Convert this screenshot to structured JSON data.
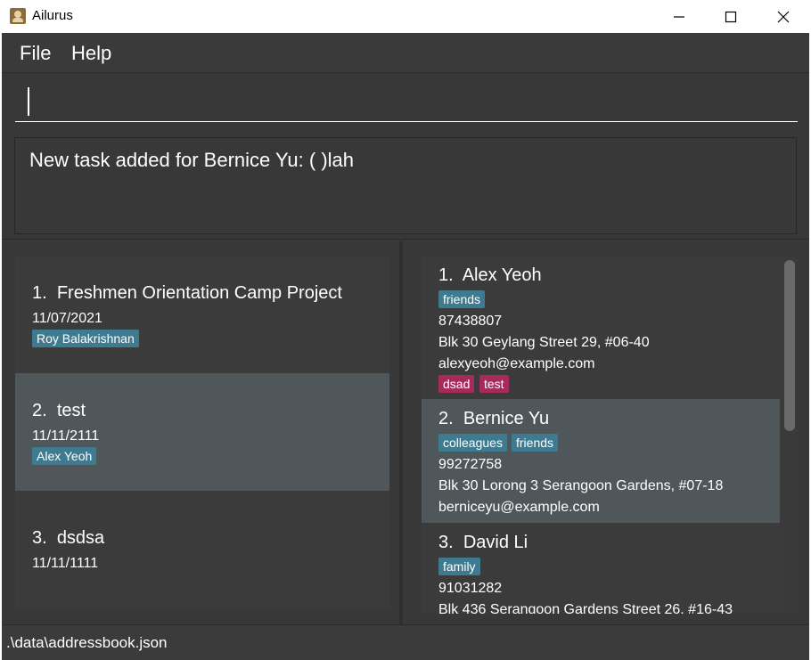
{
  "window": {
    "title": "Ailurus"
  },
  "menu": {
    "file": "File",
    "help": "Help"
  },
  "command": {
    "value": "",
    "placeholder": ""
  },
  "result": {
    "text": "New task added for Bernice Yu: ( )lah"
  },
  "tasks": [
    {
      "index": "1.",
      "title": "Freshmen Orientation Camp Project",
      "date": "11/07/2021",
      "members": [
        "Roy Balakrishnan"
      ]
    },
    {
      "index": "2.",
      "title": "test",
      "date": "11/11/2111",
      "members": [
        "Alex Yeoh"
      ]
    },
    {
      "index": "3.",
      "title": "dsdsa",
      "date": "11/11/1111",
      "members": []
    }
  ],
  "persons": [
    {
      "index": "1.",
      "name": "Alex Yeoh",
      "tags": [
        "friends"
      ],
      "phone": "87438807",
      "address": "Blk 30 Geylang Street 29, #06-40",
      "email": "alexyeoh@example.com",
      "task_tags": [
        "dsad",
        "test"
      ]
    },
    {
      "index": "2.",
      "name": "Bernice Yu",
      "tags": [
        "colleagues",
        "friends"
      ],
      "phone": "99272758",
      "address": "Blk 30 Lorong 3 Serangoon Gardens, #07-18",
      "email": "berniceyu@example.com",
      "task_tags": []
    },
    {
      "index": "3.",
      "name": "David Li",
      "tags": [
        "family"
      ],
      "phone": "91031282",
      "address": "Blk 436 Serangoon Gardens Street 26, #16-43",
      "email": "",
      "task_tags": []
    }
  ],
  "status": {
    "path": ".\\data\\addressbook.json"
  },
  "colors": {
    "tag": "#3e7b91",
    "task_tag": "#a72a5c",
    "selected": "#50575a",
    "background": "#383838"
  }
}
